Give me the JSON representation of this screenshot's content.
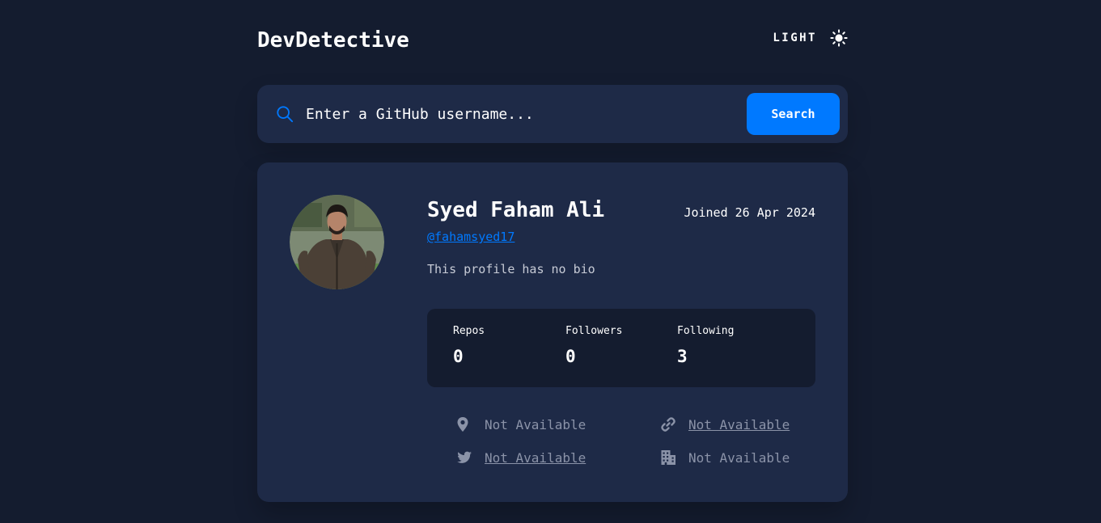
{
  "app": {
    "logo": "DevDetective",
    "mode_label": "LIGHT",
    "mode_icon": "sun-icon"
  },
  "search": {
    "placeholder": "Enter a GitHub username...",
    "value": "",
    "button_label": "Search",
    "icon": "search-icon"
  },
  "profile": {
    "name": "Syed Faham Ali",
    "joined": "Joined 26 Apr 2024",
    "username": "@fahamsyed17",
    "bio": "This profile has no bio",
    "stats": [
      {
        "label": "Repos",
        "value": "0"
      },
      {
        "label": "Followers",
        "value": "0"
      },
      {
        "label": "Following",
        "value": "3"
      }
    ],
    "links": {
      "location": {
        "text": "Not Available",
        "icon": "location-pin-icon"
      },
      "website": {
        "text": "Not Available",
        "icon": "link-icon"
      },
      "twitter": {
        "text": "Not Available",
        "icon": "twitter-icon"
      },
      "company": {
        "text": "Not Available",
        "icon": "building-icon"
      }
    }
  },
  "colors": {
    "background": "#141c2f",
    "card": "#1e2a47",
    "accent": "#0079ff",
    "muted_text": "#8b93a8"
  }
}
